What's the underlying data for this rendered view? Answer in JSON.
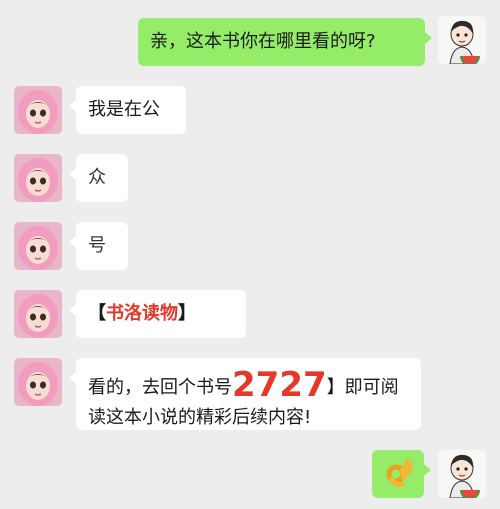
{
  "messages": [
    {
      "side": "right",
      "text": "亲，这本书你在哪里看的呀?"
    },
    {
      "side": "left",
      "text": "我是在公"
    },
    {
      "side": "left",
      "text": "众"
    },
    {
      "side": "left",
      "text": "号"
    },
    {
      "side": "left",
      "bracket_open": "【",
      "highlight": "书洛读物",
      "bracket_close": "】"
    },
    {
      "side": "left",
      "line1_pre": "看的，去回个书号",
      "number": "2727",
      "line1_post": "】即可阅",
      "line2": "读这本小说的精彩后续内容!"
    },
    {
      "side": "right",
      "emoji": "ok-hand-emoji"
    }
  ],
  "colors": {
    "background": "#ededed",
    "sent_bubble": "#95ec69",
    "received_bubble": "#ffffff",
    "highlight": "#e5382a"
  }
}
